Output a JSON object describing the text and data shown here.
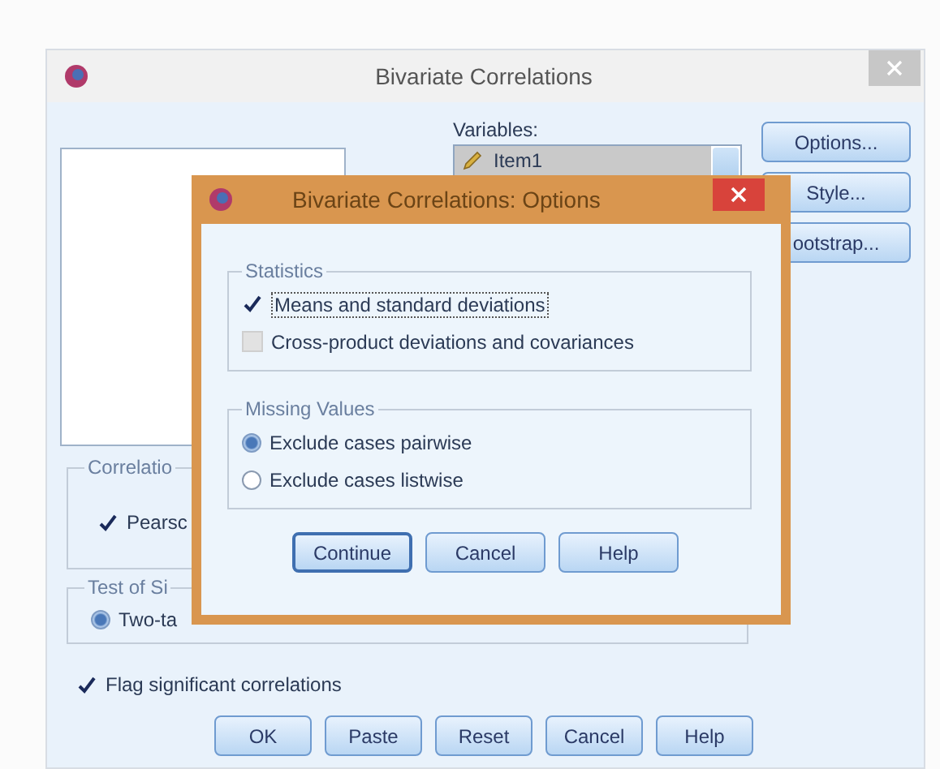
{
  "main_window": {
    "title": "Bivariate Correlations",
    "variables_label": "Variables:",
    "variables": [
      {
        "label": "Item1",
        "selected": true
      }
    ],
    "side_buttons": [
      "Options...",
      "Style...",
      "ootstrap..."
    ],
    "correlation_group": {
      "title": "Correlatio",
      "options": [
        {
          "label": "Pearsc",
          "checked": true
        }
      ]
    },
    "significance_group": {
      "title": "Test of Si",
      "options": [
        {
          "label": "Two-ta",
          "selected": true
        }
      ]
    },
    "flag": {
      "label": "Flag significant correlations",
      "checked": true
    },
    "buttons": [
      "OK",
      "Paste",
      "Reset",
      "Cancel",
      "Help"
    ]
  },
  "options_dialog": {
    "title": "Bivariate Correlations: Options",
    "statistics": {
      "title": "Statistics",
      "options": [
        {
          "label": "Means and standard deviations",
          "checked": true
        },
        {
          "label": "Cross-product deviations and covariances",
          "checked": false
        }
      ]
    },
    "missing_values": {
      "title": "Missing Values",
      "options": [
        {
          "label": "Exclude cases pairwise",
          "selected": true
        },
        {
          "label": "Exclude cases listwise",
          "selected": false
        }
      ]
    },
    "buttons": [
      "Continue",
      "Cancel",
      "Help"
    ]
  }
}
